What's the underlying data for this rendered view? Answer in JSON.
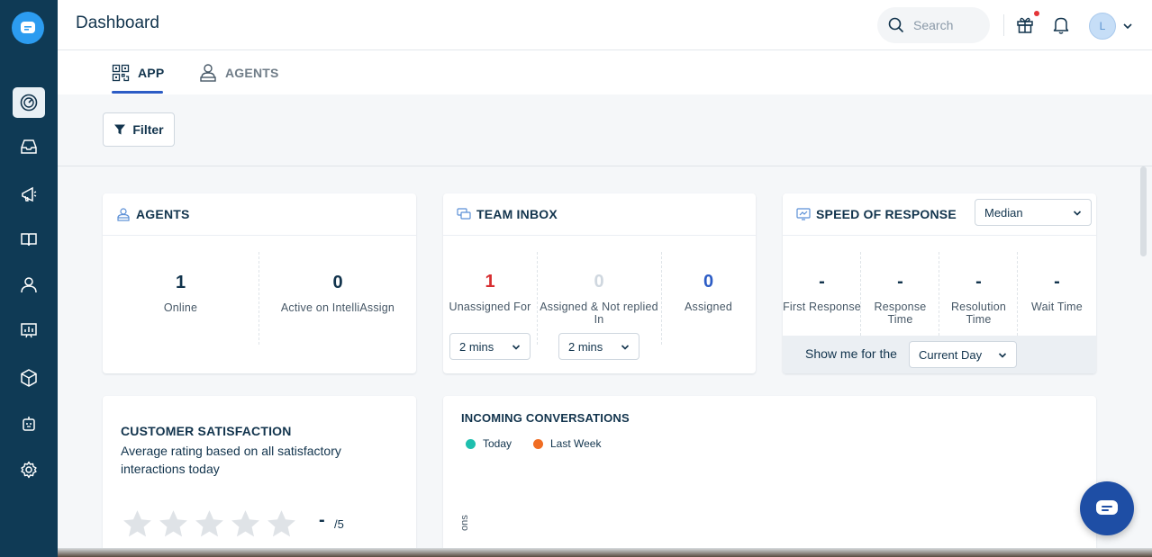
{
  "header": {
    "title": "Dashboard",
    "search_placeholder": "Search",
    "avatar_initial": "L"
  },
  "sidebar": {
    "items": [
      {
        "icon": "dashboard-icon",
        "active": true
      },
      {
        "icon": "inbox-icon",
        "active": false
      },
      {
        "icon": "campaigns-icon",
        "active": false
      },
      {
        "icon": "knowledge-base-icon",
        "active": false
      },
      {
        "icon": "contacts-icon",
        "active": false
      },
      {
        "icon": "reports-icon",
        "active": false
      },
      {
        "icon": "apps-icon",
        "active": false
      },
      {
        "icon": "bot-icon",
        "active": false
      },
      {
        "icon": "settings-icon",
        "active": false
      }
    ]
  },
  "tabs": [
    {
      "label": "APP",
      "active": true
    },
    {
      "label": "AGENTS",
      "active": false
    }
  ],
  "filter": {
    "label": "Filter"
  },
  "agents_card": {
    "title": "AGENTS",
    "metrics": [
      {
        "value": "1",
        "label": "Online"
      },
      {
        "value": "0",
        "label": "Active on IntelliAssign"
      }
    ]
  },
  "team_inbox_card": {
    "title": "TEAM INBOX",
    "metrics": [
      {
        "value": "1",
        "label": "Unassigned For",
        "color": "#d72d30",
        "select": "2 mins"
      },
      {
        "value": "0",
        "label": "Assigned & Not replied In",
        "color": "#cfd7df",
        "select": "2 mins"
      },
      {
        "value": "0",
        "label": "Assigned",
        "color": "#2c5cc5"
      }
    ]
  },
  "speed_card": {
    "title": "SPEED OF RESPONSE",
    "select": "Median",
    "metrics": [
      {
        "value": "-",
        "label": "First Response"
      },
      {
        "value": "-",
        "label": "Response Time"
      },
      {
        "value": "-",
        "label": "Resolution Time"
      },
      {
        "value": "-",
        "label": "Wait Time"
      }
    ],
    "footer_label": "Show me for the",
    "footer_select": "Current Day"
  },
  "csat_card": {
    "title": "CUSTOMER SATISFACTION",
    "description": "Average rating based on all satisfactory interactions today",
    "rating": "-",
    "rating_max": "/5"
  },
  "incoming_card": {
    "title": "INCOMING CONVERSATIONS",
    "legend": [
      {
        "label": "Today",
        "color": "#1ebfae"
      },
      {
        "label": "Last Week",
        "color": "#f06d23"
      }
    ],
    "yaxis_partial": "ons"
  }
}
